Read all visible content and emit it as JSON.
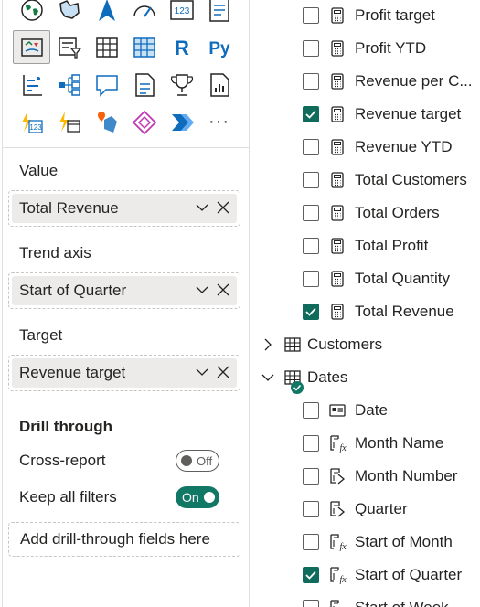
{
  "visualizations": {
    "rows": [
      [
        "globe-map-icon",
        "filled-map-icon",
        "arrow-visual-icon",
        "gauge-icon",
        "card-123-icon",
        "multi-row-card-icon"
      ],
      [
        "kpi-icon",
        "slicer-icon",
        "table-icon",
        "matrix-icon",
        "r-visual-icon",
        "python-visual-icon"
      ],
      [
        "key-influencers-icon",
        "decomposition-tree-icon",
        "qa-icon",
        "smart-narrative-icon",
        "trophy-icon",
        "paginated-report-icon"
      ],
      [
        "power-apps-icon",
        "power-automate-icon",
        "azure-map-icon",
        "fabric-icon",
        "power-automate-flow-icon",
        "more-visuals-icon"
      ]
    ],
    "r_label": "R",
    "py_label": "Py",
    "card_label": "123",
    "more_label": "···"
  },
  "wells": {
    "value": {
      "label": "Value",
      "field": "Total Revenue"
    },
    "trend": {
      "label": "Trend axis",
      "field": "Start of Quarter"
    },
    "target": {
      "label": "Target",
      "field": "Revenue target"
    }
  },
  "drill": {
    "title": "Drill through",
    "cross_report_label": "Cross-report",
    "cross_report_state": "Off",
    "keep_filters_label": "Keep all filters",
    "keep_filters_state": "On",
    "add_fields_placeholder": "Add drill-through fields here"
  },
  "fields": {
    "measures": [
      {
        "name": "Profit target",
        "checked": false
      },
      {
        "name": "Profit YTD",
        "checked": false
      },
      {
        "name": "Revenue per C...",
        "checked": false
      },
      {
        "name": "Revenue target",
        "checked": true
      },
      {
        "name": "Revenue YTD",
        "checked": false
      },
      {
        "name": "Total Customers",
        "checked": false
      },
      {
        "name": "Total Orders",
        "checked": false
      },
      {
        "name": "Total Profit",
        "checked": false
      },
      {
        "name": "Total Quantity",
        "checked": false
      },
      {
        "name": "Total Revenue",
        "checked": true
      }
    ],
    "customers_table": "Customers",
    "dates_table": "Dates",
    "dates_fields": [
      {
        "name": "Date",
        "checked": false,
        "icon": "date-field-icon"
      },
      {
        "name": "Month Name",
        "checked": false,
        "icon": "calculated-column-icon"
      },
      {
        "name": "Month Number",
        "checked": false,
        "icon": "sort-column-icon"
      },
      {
        "name": "Quarter",
        "checked": false,
        "icon": "sort-column-icon"
      },
      {
        "name": "Start of Month",
        "checked": false,
        "icon": "calculated-column-icon"
      },
      {
        "name": "Start of Quarter",
        "checked": true,
        "icon": "calculated-column-icon"
      },
      {
        "name": "Start of Week",
        "checked": false,
        "icon": "calculated-column-icon"
      }
    ]
  },
  "colors": {
    "accent": "#117865",
    "pill_bg": "#edebe9",
    "text": "#252423"
  }
}
